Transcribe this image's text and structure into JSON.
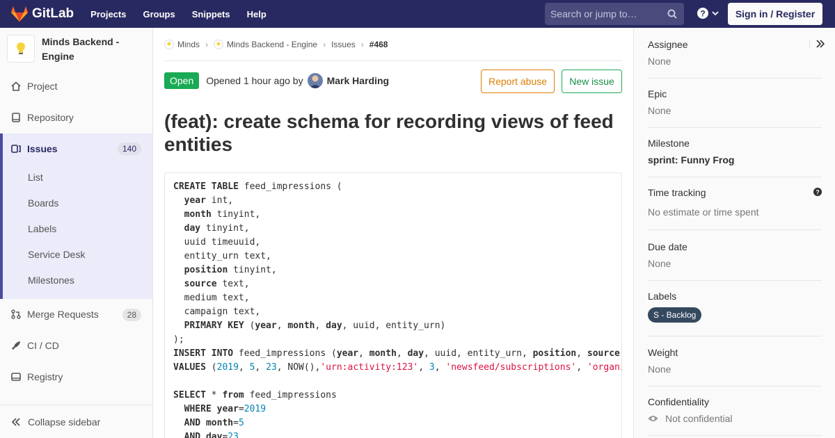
{
  "navbar": {
    "brand": "GitLab",
    "links": [
      "Projects",
      "Groups",
      "Snippets",
      "Help"
    ],
    "search_placeholder": "Search or jump to…",
    "signin": "Sign in / Register"
  },
  "sidebar": {
    "project_name": "Minds Backend - Engine",
    "items": {
      "project": "Project",
      "repository": "Repository",
      "issues": "Issues",
      "issues_count": "140",
      "merge_requests": "Merge Requests",
      "mr_count": "28",
      "cicd": "CI / CD",
      "registry": "Registry"
    },
    "issue_subitems": [
      "List",
      "Boards",
      "Labels",
      "Service Desk",
      "Milestones"
    ],
    "collapse": "Collapse sidebar"
  },
  "breadcrumb": [
    "Minds",
    "Minds Backend - Engine",
    "Issues",
    "#468"
  ],
  "issue": {
    "status": "Open",
    "opened_text": "Opened 1 hour ago by",
    "author": "Mark Harding",
    "report_abuse": "Report abuse",
    "new_issue": "New issue",
    "title": "(feat): create schema for recording views of feed entities"
  },
  "right_sidebar": {
    "assignee_title": "Assignee",
    "assignee_value": "None",
    "epic_title": "Epic",
    "epic_value": "None",
    "milestone_title": "Milestone",
    "milestone_value": "sprint: Funny Frog",
    "time_title": "Time tracking",
    "time_value": "No estimate or time spent",
    "due_title": "Due date",
    "due_value": "None",
    "labels_title": "Labels",
    "label": "S - Backlog",
    "label_color": "#34495e",
    "weight_title": "Weight",
    "weight_value": "None",
    "conf_title": "Confidentiality",
    "conf_value": "Not confidential"
  },
  "colors": {
    "navbar": "#292961",
    "open": "#1aaa55",
    "report": "#de7e00",
    "sidebar_active": "#ebebfa"
  }
}
